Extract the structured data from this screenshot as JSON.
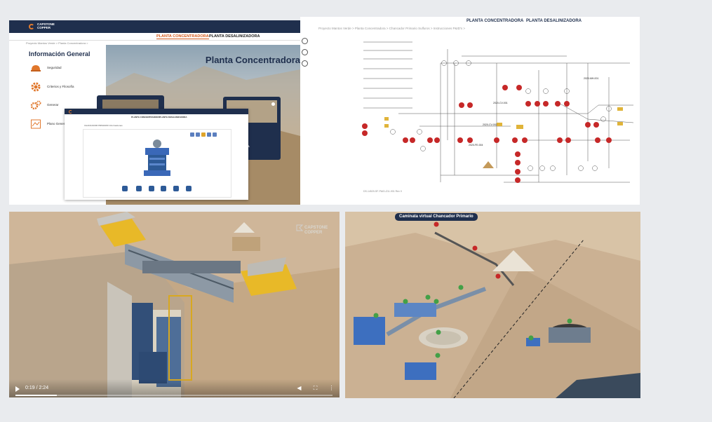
{
  "portal": {
    "brand_line1": "CAPSTONE",
    "brand_line2": "COPPER",
    "tab_concentradora": "PLANTA CONCENTRADORA",
    "tab_desalinizadora": "PLANTA DESALINIZADORA",
    "breadcrumb": "Proyecto Mantos Verde  >  Planta Concentradora  >",
    "sidebar_title": "Información General",
    "sidebar_items": [
      {
        "label": "Seguridad",
        "icon": "helmet-icon"
      },
      {
        "label": "Criterios y Filosofía",
        "icon": "gear-icon"
      },
      {
        "label": "Generar",
        "icon": "gears-icon"
      },
      {
        "label": "Plano General",
        "icon": "map-icon"
      }
    ],
    "hero_title": "Planta Concentradora",
    "card_text": "NCIA"
  },
  "inset": {
    "tab_concentradora": "PLANTA CONCENTRADORA",
    "tab_desalinizadora": "PLANTA DESALINIZADORA",
    "breadcrumb": "CHANCADOR PRIMARIO   Informaciones"
  },
  "pid": {
    "tab_concentradora": "PLANTA CONCENTRADORA",
    "tab_desalinizadora": "PLANTA DESALINIZADORA",
    "breadcrumb": "Proyecto Mantos Verde  >  Planta Concentradora  >  Chancador Primario Sulfuros  >  Instrucciones P&ID's  >",
    "tag_a": "2020-CV-001",
    "tag_b": "2020-MH-001",
    "tag_c": "2020-FE-004",
    "tag_d": "2020-CV-002",
    "footer": "DS-14520-SF-P&ID-Z11-001 Rev 0"
  },
  "video": {
    "time": "0:19 / 2:24",
    "progress": 0.13,
    "brand_line1": "CAPSTONE",
    "brand_line2": "COPPER"
  },
  "walk": {
    "label": "Caminata virtual Chancador Primario"
  },
  "colors": {
    "navy": "#1f2f4d",
    "orange": "#d45a1c",
    "valve_red": "#c62828",
    "marker_green": "#43a047"
  }
}
